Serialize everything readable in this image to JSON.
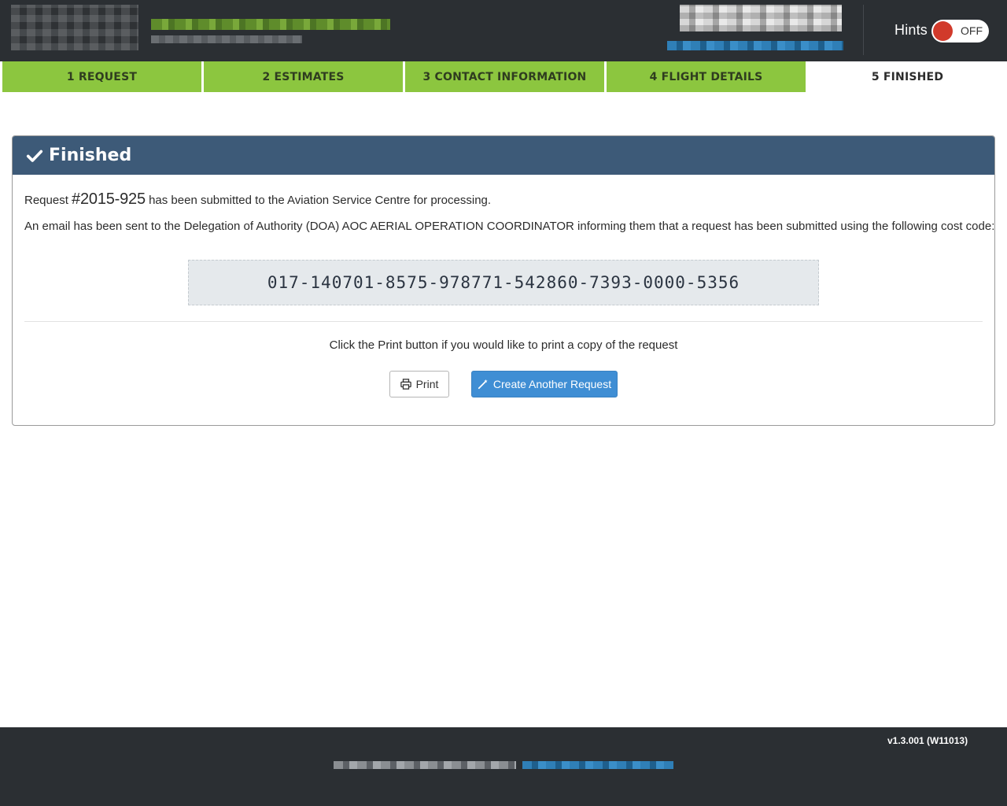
{
  "header": {
    "hints_label": "Hints",
    "hints_toggle_state": "OFF"
  },
  "steps": [
    {
      "label": "1 REQUEST",
      "state": "complete"
    },
    {
      "label": "2 ESTIMATES",
      "state": "complete"
    },
    {
      "label": "3 CONTACT INFORMATION",
      "state": "complete"
    },
    {
      "label": "4 FLIGHT DETAILS",
      "state": "complete"
    },
    {
      "label": "5 FINISHED",
      "state": "active"
    }
  ],
  "panel": {
    "title": "Finished",
    "line1_prefix": "Request ",
    "request_number": "#2015-925",
    "line1_suffix": " has been submitted to the Aviation Service Centre for processing.",
    "line2": "An email has been sent to the Delegation of Authority (DOA) AOC AERIAL OPERATION COORDINATOR informing them that a request has been submitted using the following cost code:",
    "cost_code": "017-140701-8575-978771-542860-7393-0000-5356",
    "print_hint": "Click the Print button if you would like to print a copy of the request",
    "print_button": "Print",
    "create_button": "Create Another Request"
  },
  "footer": {
    "version": "v1.3.001 (W11013)"
  },
  "colors": {
    "header_bg": "#2b2f33",
    "step_complete": "#8cc63f",
    "panel_heading": "#3d5a78",
    "primary_button": "#3f8ed4",
    "toggle_knob": "#d13a2b"
  }
}
